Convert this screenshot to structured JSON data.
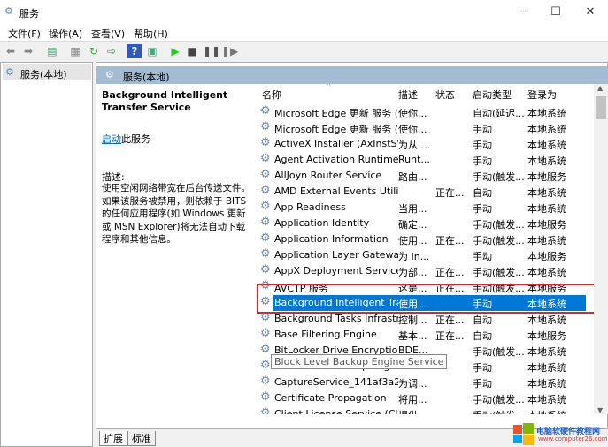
{
  "window": {
    "title": "服务",
    "minimize": "─",
    "maximize": "☐",
    "close": "✕"
  },
  "menu": [
    "文件(F)",
    "操作(A)",
    "查看(V)",
    "帮助(H)"
  ],
  "toolbar": {
    "icons": [
      "back-icon",
      "forward-icon",
      "console-tree-icon",
      "properties-icon",
      "refresh-icon",
      "export-icon",
      "help-icon",
      "view-icon",
      "play-icon",
      "stop-icon",
      "pause-icon",
      "resume-icon"
    ]
  },
  "tree": {
    "item": "服务(本地)"
  },
  "pane": {
    "header": "服务(本地)"
  },
  "detail": {
    "title": "Background Intelligent Transfer Service",
    "start_link": "启动",
    "start_suffix": "此服务",
    "desc_label": "描述:",
    "desc": "使用空闲网络带宽在后台传送文件。如果该服务被禁用，则依赖于 BITS 的任何应用程序(如 Windows 更新或 MSN Explorer)将无法自动下载程序和其他信息。"
  },
  "columns": [
    "名称",
    "描述",
    "状态",
    "启动类型",
    "登录为"
  ],
  "rows": [
    [
      "Microsoft Edge 更新 服务 (...",
      "使你...",
      "",
      "自动(延迟...",
      "本地系统"
    ],
    [
      "Microsoft Edge 更新 服务 (...",
      "使你...",
      "",
      "手动",
      "本地系统"
    ],
    [
      "ActiveX Installer (AxInstSV)",
      "为从 ...",
      "",
      "手动",
      "本地系统"
    ],
    [
      "Agent Activation Runtime_...",
      "Runt...",
      "",
      "手动",
      "本地系统"
    ],
    [
      "AllJoyn Router Service",
      "路由...",
      "",
      "手动(触发...",
      "本地服务"
    ],
    [
      "AMD External Events Utility",
      "",
      "正在...",
      "自动",
      "本地系统"
    ],
    [
      "App Readiness",
      "当用...",
      "",
      "手动",
      "本地系统"
    ],
    [
      "Application Identity",
      "确定...",
      "",
      "手动(触发...",
      "本地服务"
    ],
    [
      "Application Information",
      "使用...",
      "正在...",
      "手动(触发...",
      "本地系统"
    ],
    [
      "Application Layer Gateway ...",
      "为 In...",
      "",
      "手动",
      "本地服务"
    ],
    [
      "AppX Deployment Service ...",
      "为部...",
      "正在...",
      "手动(触发...",
      "本地系统"
    ],
    [
      "AVCTP 服务",
      "这是...",
      "正在...",
      "手动(触发...",
      "本地服务"
    ],
    [
      "Background Intelligent Tra...",
      "使用...",
      "",
      "手动",
      "本地系统"
    ],
    [
      "Background Tasks Infrastru...",
      "控制...",
      "正在...",
      "自动",
      "本地系统"
    ],
    [
      "Base Filtering Engine",
      "基本...",
      "正在...",
      "自动",
      "本地服务"
    ],
    [
      "BitLocker Drive Encryption ...",
      "BDE...",
      "",
      "手动(触发...",
      "本地系统"
    ],
    [
      "Block Level Backup Engine Service",
      "",
      "",
      "手动",
      "本地系统"
    ],
    [
      "CaptureService_141af3a2",
      "为调...",
      "",
      "手动",
      "本地系统"
    ],
    [
      "Certificate Propagation",
      "将用...",
      "",
      "手动(触发...",
      "本地系统"
    ],
    [
      "Client License Service (Clip...",
      "提供...",
      "",
      "手动(触发...",
      "本地系统"
    ]
  ],
  "selected_row": 12,
  "tooltip": "Block Level Backup Engine Service",
  "tabs": [
    "扩展",
    "标准"
  ],
  "watermark": {
    "text": "电脑软硬件教程网",
    "url": "www.computer26.com"
  },
  "colors": {
    "selection": "#0078d7",
    "highlight_box": "#e8202a",
    "header": "#a4bbd4"
  }
}
